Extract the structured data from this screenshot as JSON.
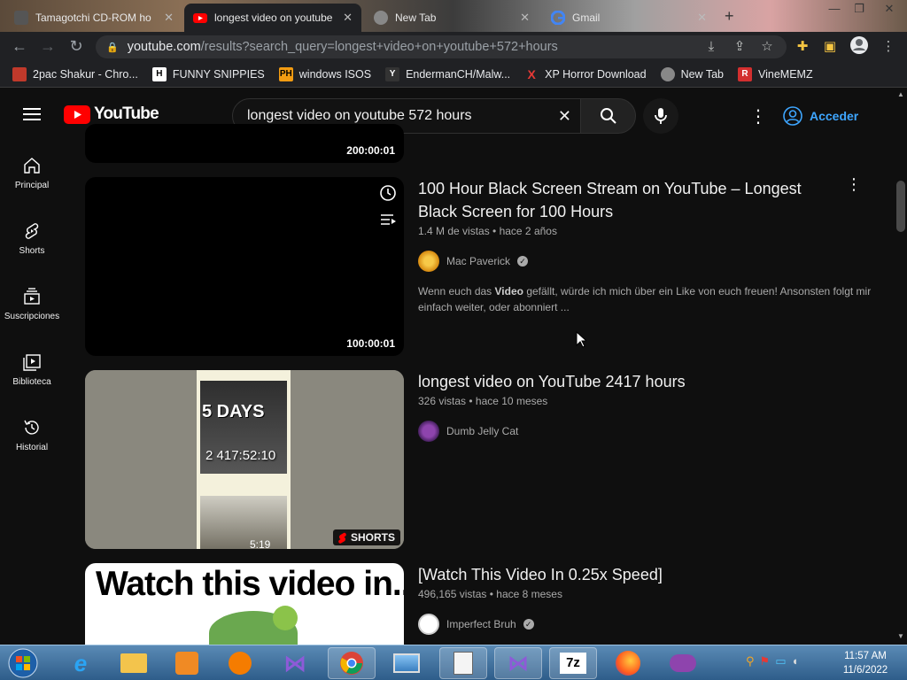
{
  "browser": {
    "tabs": [
      {
        "label": "Tamagotchi CD-ROM ho",
        "favicon": "tab-favicon-generic"
      },
      {
        "label": "longest video on youtube",
        "favicon": "youtube-icon",
        "active": true
      },
      {
        "label": "New Tab",
        "favicon": "globe-icon"
      },
      {
        "label": "Gmail",
        "favicon": "google-icon"
      }
    ],
    "url_host": "youtube.com",
    "url_path": "/results?search_query=longest+video+on+youtube+572+hours",
    "bookmarks": [
      {
        "label": "2pac Shakur - Chro...",
        "icon": "2pac-icon",
        "color": "#c0392b"
      },
      {
        "label": "FUNNY SNIPPIES",
        "icon": "h-icon",
        "color": "#333333"
      },
      {
        "label": "windows ISOS",
        "icon": "ph-icon",
        "color": "#f39c12"
      },
      {
        "label": "EndermanCH/Malw...",
        "icon": "yt-dark-icon",
        "color": "#555555"
      },
      {
        "label": "XP Horror Download",
        "icon": "x-icon",
        "color": "#e53935"
      },
      {
        "label": "New Tab",
        "icon": "globe-icon",
        "color": "#888888"
      },
      {
        "label": "VineMEMZ",
        "icon": "r-icon",
        "color": "#d32f2f"
      }
    ]
  },
  "youtube": {
    "logo_text": "YouTube",
    "search_value": "longest video on youtube 572 hours",
    "signin_label": "Acceder",
    "sidebar": [
      {
        "label": "Principal",
        "icon": "home-icon"
      },
      {
        "label": "Shorts",
        "icon": "shorts-icon"
      },
      {
        "label": "Suscripciones",
        "icon": "subscriptions-icon"
      },
      {
        "label": "Biblioteca",
        "icon": "library-icon"
      },
      {
        "label": "Historial",
        "icon": "history-icon"
      }
    ],
    "results": [
      {
        "duration": "200:00:01"
      },
      {
        "title": "100 Hour Black Screen Stream on YouTube – Longest Black Screen for 100 Hours",
        "views": "1.4 M de vistas",
        "age": "hace 2 años",
        "channel": "Mac Paverick",
        "verified": true,
        "desc_pre": "Wenn euch das ",
        "desc_bold": "Video",
        "desc_post": " gefällt, würde ich mich über ein Like von euch freuen! Ansonsten folgt mir einfach weiter, oder abonniert ...",
        "duration": "100:00:01"
      },
      {
        "title": "longest video on YouTube 2417 hours",
        "views": "326 vistas",
        "age": "hace 10 meses",
        "channel": "Dumb Jelly Cat",
        "verified": false,
        "overlay_days": "5 DAYS",
        "overlay_time": "2 417:52:10",
        "overlay_small": "5:19",
        "shorts_label": "SHORTS"
      },
      {
        "title": "[Watch This Video In 0.25x Speed]",
        "views": "496,165 vistas",
        "age": "hace 8 meses",
        "channel": "Imperfect Bruh",
        "verified": true,
        "thumb_text": "Watch this video in..."
      }
    ]
  },
  "taskbar": {
    "clock_time": "11:57 AM",
    "clock_date": "11/6/2022",
    "apps": [
      "start-orb-icon",
      "internet-explorer-icon",
      "file-explorer-icon",
      "media-player-icon",
      "vlc-icon",
      "visual-studio-icon",
      "chrome-icon",
      "photo-viewer-icon",
      "notepad-icon",
      "visual-studio-installer-icon",
      "7zip-icon",
      "firefox-icon",
      "mask-icon"
    ]
  }
}
